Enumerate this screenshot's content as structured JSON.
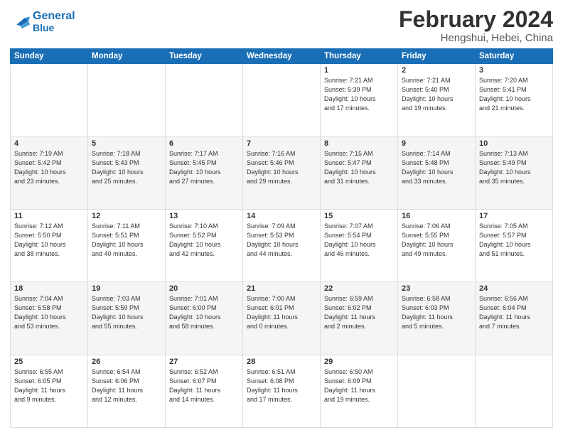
{
  "header": {
    "logo_line1": "General",
    "logo_line2": "Blue",
    "main_title": "February 2024",
    "sub_title": "Hengshui, Hebei, China"
  },
  "weekdays": [
    "Sunday",
    "Monday",
    "Tuesday",
    "Wednesday",
    "Thursday",
    "Friday",
    "Saturday"
  ],
  "weeks": [
    [
      {
        "day": "",
        "info": ""
      },
      {
        "day": "",
        "info": ""
      },
      {
        "day": "",
        "info": ""
      },
      {
        "day": "",
        "info": ""
      },
      {
        "day": "1",
        "info": "Sunrise: 7:21 AM\nSunset: 5:39 PM\nDaylight: 10 hours\nand 17 minutes."
      },
      {
        "day": "2",
        "info": "Sunrise: 7:21 AM\nSunset: 5:40 PM\nDaylight: 10 hours\nand 19 minutes."
      },
      {
        "day": "3",
        "info": "Sunrise: 7:20 AM\nSunset: 5:41 PM\nDaylight: 10 hours\nand 21 minutes."
      }
    ],
    [
      {
        "day": "4",
        "info": "Sunrise: 7:19 AM\nSunset: 5:42 PM\nDaylight: 10 hours\nand 23 minutes."
      },
      {
        "day": "5",
        "info": "Sunrise: 7:18 AM\nSunset: 5:43 PM\nDaylight: 10 hours\nand 25 minutes."
      },
      {
        "day": "6",
        "info": "Sunrise: 7:17 AM\nSunset: 5:45 PM\nDaylight: 10 hours\nand 27 minutes."
      },
      {
        "day": "7",
        "info": "Sunrise: 7:16 AM\nSunset: 5:46 PM\nDaylight: 10 hours\nand 29 minutes."
      },
      {
        "day": "8",
        "info": "Sunrise: 7:15 AM\nSunset: 5:47 PM\nDaylight: 10 hours\nand 31 minutes."
      },
      {
        "day": "9",
        "info": "Sunrise: 7:14 AM\nSunset: 5:48 PM\nDaylight: 10 hours\nand 33 minutes."
      },
      {
        "day": "10",
        "info": "Sunrise: 7:13 AM\nSunset: 5:49 PM\nDaylight: 10 hours\nand 35 minutes."
      }
    ],
    [
      {
        "day": "11",
        "info": "Sunrise: 7:12 AM\nSunset: 5:50 PM\nDaylight: 10 hours\nand 38 minutes."
      },
      {
        "day": "12",
        "info": "Sunrise: 7:11 AM\nSunset: 5:51 PM\nDaylight: 10 hours\nand 40 minutes."
      },
      {
        "day": "13",
        "info": "Sunrise: 7:10 AM\nSunset: 5:52 PM\nDaylight: 10 hours\nand 42 minutes."
      },
      {
        "day": "14",
        "info": "Sunrise: 7:09 AM\nSunset: 5:53 PM\nDaylight: 10 hours\nand 44 minutes."
      },
      {
        "day": "15",
        "info": "Sunrise: 7:07 AM\nSunset: 5:54 PM\nDaylight: 10 hours\nand 46 minutes."
      },
      {
        "day": "16",
        "info": "Sunrise: 7:06 AM\nSunset: 5:55 PM\nDaylight: 10 hours\nand 49 minutes."
      },
      {
        "day": "17",
        "info": "Sunrise: 7:05 AM\nSunset: 5:57 PM\nDaylight: 10 hours\nand 51 minutes."
      }
    ],
    [
      {
        "day": "18",
        "info": "Sunrise: 7:04 AM\nSunset: 5:58 PM\nDaylight: 10 hours\nand 53 minutes."
      },
      {
        "day": "19",
        "info": "Sunrise: 7:03 AM\nSunset: 5:59 PM\nDaylight: 10 hours\nand 55 minutes."
      },
      {
        "day": "20",
        "info": "Sunrise: 7:01 AM\nSunset: 6:00 PM\nDaylight: 10 hours\nand 58 minutes."
      },
      {
        "day": "21",
        "info": "Sunrise: 7:00 AM\nSunset: 6:01 PM\nDaylight: 11 hours\nand 0 minutes."
      },
      {
        "day": "22",
        "info": "Sunrise: 6:59 AM\nSunset: 6:02 PM\nDaylight: 11 hours\nand 2 minutes."
      },
      {
        "day": "23",
        "info": "Sunrise: 6:58 AM\nSunset: 6:03 PM\nDaylight: 11 hours\nand 5 minutes."
      },
      {
        "day": "24",
        "info": "Sunrise: 6:56 AM\nSunset: 6:04 PM\nDaylight: 11 hours\nand 7 minutes."
      }
    ],
    [
      {
        "day": "25",
        "info": "Sunrise: 6:55 AM\nSunset: 6:05 PM\nDaylight: 11 hours\nand 9 minutes."
      },
      {
        "day": "26",
        "info": "Sunrise: 6:54 AM\nSunset: 6:06 PM\nDaylight: 11 hours\nand 12 minutes."
      },
      {
        "day": "27",
        "info": "Sunrise: 6:52 AM\nSunset: 6:07 PM\nDaylight: 11 hours\nand 14 minutes."
      },
      {
        "day": "28",
        "info": "Sunrise: 6:51 AM\nSunset: 6:08 PM\nDaylight: 11 hours\nand 17 minutes."
      },
      {
        "day": "29",
        "info": "Sunrise: 6:50 AM\nSunset: 6:09 PM\nDaylight: 11 hours\nand 19 minutes."
      },
      {
        "day": "",
        "info": ""
      },
      {
        "day": "",
        "info": ""
      }
    ]
  ]
}
